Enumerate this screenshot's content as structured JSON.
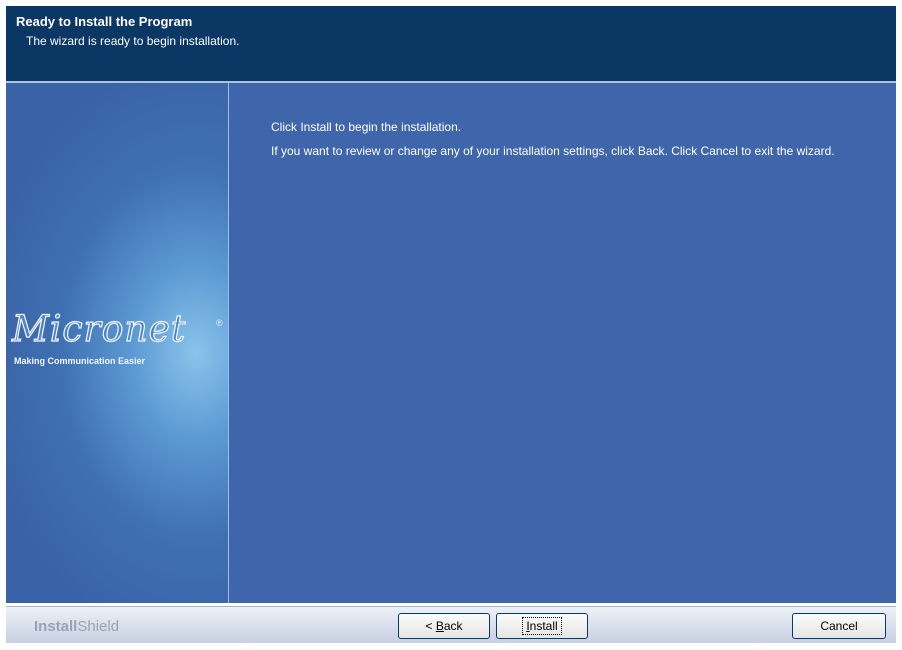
{
  "header": {
    "title": "Ready to Install the Program",
    "subtitle": "The wizard is ready to begin installation."
  },
  "content": {
    "paragraph_1": "Click Install to begin the installation.",
    "paragraph_2": "If you want to review or change any of your installation settings, click Back. Click Cancel to exit the wizard."
  },
  "branding": {
    "logo_text": "Micronet",
    "logo_registered": "®",
    "tagline": "Making Communication Easier",
    "installer_brand_bold": "Install",
    "installer_brand_thin": "Shield"
  },
  "buttons": {
    "back_prefix": "< ",
    "back_accel": "B",
    "back_rest": "ack",
    "install_accel": "I",
    "install_rest": "nstall",
    "cancel_label": "Cancel"
  },
  "colors": {
    "header_bg": "#0b3765",
    "body_bg": "#3f66aa",
    "text": "#ffffff"
  }
}
